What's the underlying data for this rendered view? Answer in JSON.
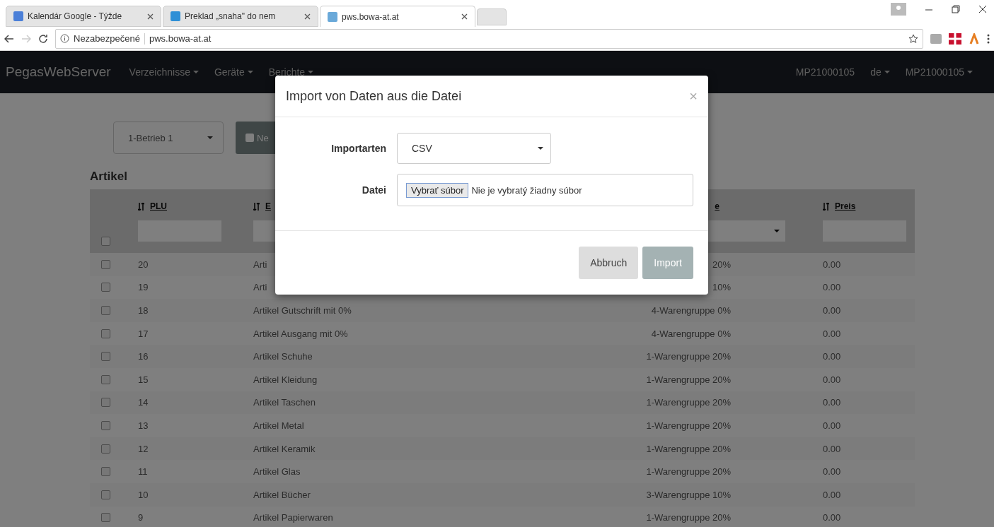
{
  "browser": {
    "tabs": [
      {
        "title": "Kalendár Google - Týžde",
        "selected": false
      },
      {
        "title": "Preklad „snaha\" do nem",
        "selected": false
      },
      {
        "title": "pws.bowa-at.at",
        "selected": true
      }
    ],
    "security": "Nezabezpečené",
    "url": "pws.bowa-at.at"
  },
  "navbar": {
    "brand": "PegasWebServer",
    "menus": [
      "Verzeichnisse",
      "Geräte",
      "Berichte"
    ],
    "right": [
      {
        "label": "MP21000105",
        "dropdown": false
      },
      {
        "label": "de",
        "dropdown": true
      },
      {
        "label": "MP21000105",
        "dropdown": true
      }
    ]
  },
  "toolbar": {
    "site_select": "1-Betrieb 1",
    "new_button": "Ne"
  },
  "section_title": "Artikel",
  "table": {
    "select_all_checked": false,
    "columns": [
      "PLU",
      "E",
      "e",
      "Preis"
    ],
    "rows": [
      {
        "plu": "20",
        "name": "Arti",
        "group": "20%",
        "price": "0.00",
        "checked": false
      },
      {
        "plu": "19",
        "name": "Arti",
        "group": "10%",
        "price": "0.00",
        "checked": false
      },
      {
        "plu": "18",
        "name": "Artikel Gutschrift mit 0%",
        "group": "4-Warengruppe 0%",
        "price": "0.00",
        "checked": false
      },
      {
        "plu": "17",
        "name": "Artikel Ausgang mit 0%",
        "group": "4-Warengruppe 0%",
        "price": "0.00",
        "checked": false
      },
      {
        "plu": "16",
        "name": "Artikel Schuhe",
        "group": "1-Warengruppe 20%",
        "price": "0.00",
        "checked": false
      },
      {
        "plu": "15",
        "name": "Artikel Kleidung",
        "group": "1-Warengruppe 20%",
        "price": "0.00",
        "checked": false
      },
      {
        "plu": "14",
        "name": "Artikel Taschen",
        "group": "1-Warengruppe 20%",
        "price": "0.00",
        "checked": false
      },
      {
        "plu": "13",
        "name": "Artikel Metal",
        "group": "1-Warengruppe 20%",
        "price": "0.00",
        "checked": false
      },
      {
        "plu": "12",
        "name": "Artikel Keramik",
        "group": "1-Warengruppe 20%",
        "price": "0.00",
        "checked": false
      },
      {
        "plu": "11",
        "name": "Artikel Glas",
        "group": "1-Warengruppe 20%",
        "price": "0.00",
        "checked": false
      },
      {
        "plu": "10",
        "name": "Artikel Bücher",
        "group": "3-Warengruppe 10%",
        "price": "0.00",
        "checked": false
      },
      {
        "plu": "9",
        "name": "Artikel Papierwaren",
        "group": "1-Warengruppe 20%",
        "price": "0.00",
        "checked": false
      }
    ]
  },
  "dialog": {
    "title": "Import von Daten aus die Datei",
    "close": "×",
    "fields": [
      {
        "kind": "select",
        "label": "Importarten",
        "value": "CSV"
      },
      {
        "kind": "file",
        "label": "Datei",
        "button": "Vybrať súbor",
        "status": "Nie je vybratý žiadny súbor"
      }
    ],
    "buttons": [
      {
        "label": "Abbruch",
        "kind": "cancel",
        "disabled": false
      },
      {
        "label": "Import",
        "kind": "primary",
        "disabled": true
      }
    ]
  }
}
